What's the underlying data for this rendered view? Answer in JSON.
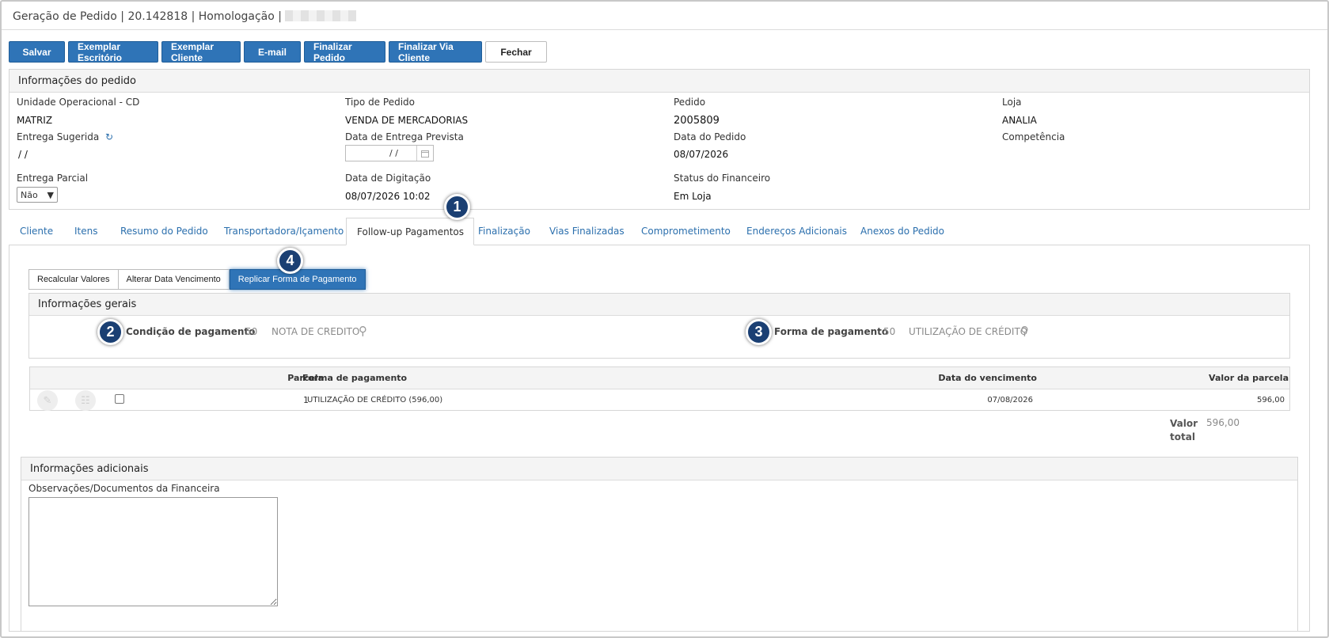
{
  "window": {
    "title": "Geração de Pedido | 20.142818 | Homologação |"
  },
  "toolbar": {
    "buttons": [
      "Salvar",
      "Exemplar Escritório",
      "Exemplar Cliente",
      "E-mail",
      "Finalizar Pedido",
      "Finalizar Via Cliente",
      "Fechar"
    ]
  },
  "info": {
    "header": "Informações do pedido",
    "unidade_label": "Unidade Operacional - CD",
    "unidade_value": "MATRIZ",
    "tipo_label": "Tipo de Pedido",
    "tipo_value": "VENDA DE MERCADORIAS",
    "pedido_label": "Pedido",
    "pedido_value": "2005809",
    "loja_label": "Loja",
    "loja_value": "ANALIA",
    "entrega_sugerida_label": "Entrega Sugerida",
    "entrega_sugerida_value": "/ /",
    "data_entrega_label": "Data de Entrega Prevista",
    "data_entrega_value": "/ /",
    "data_pedido_label": "Data do Pedido",
    "data_pedido_value": "08/07/2026",
    "competencia_label": "Competência",
    "entrega_parcial_label": "Entrega Parcial",
    "entrega_parcial_value": "Não",
    "data_digitacao_label": "Data de Digitação",
    "data_digitacao_value": "08/07/2026 10:02",
    "status_fin_label": "Status do Financeiro",
    "status_fin_value": "Em Loja"
  },
  "tabs": [
    "Cliente",
    "Itens",
    "Resumo do Pedido",
    "Transportadora/Içamento",
    "Follow-up Pagamentos",
    "Finalização",
    "Vias Finalizadas",
    "Comprometimento",
    "Endereços Adicionais",
    "Anexos do Pedido"
  ],
  "active_tab": "Follow-up Pagamentos",
  "sub_buttons": [
    "Recalcular Valores",
    "Alterar Data Vencimento",
    "Replicar Forma de Pagamento"
  ],
  "geral": {
    "header": "Informações gerais",
    "condicao_label": "Condição de pagamento",
    "condicao_code": "50",
    "condicao_desc": "NOTA DE CREDITO",
    "forma_label": "Forma de pagamento",
    "forma_code": "50",
    "forma_desc": "UTILIZAÇÃO DE CRÉDITO"
  },
  "grid": {
    "columns": [
      "Parcela",
      "Forma de pagamento",
      "Data do vencimento",
      "Valor da parcela"
    ],
    "rows": [
      {
        "parcela": "1",
        "forma": "UTILIZAÇÃO DE CRÉDITO (596,00)",
        "vencimento": "07/08/2026",
        "valor": "596,00"
      }
    ]
  },
  "total": {
    "label_1": "Valor",
    "label_2": "total",
    "value": "596,00"
  },
  "adicionais": {
    "header": "Informações adicionais",
    "obs_label": "Observações/Documentos da Financeira",
    "obs_value": ""
  },
  "markers": [
    "1",
    "2",
    "3",
    "4"
  ],
  "colors": {
    "primary_button": "#2f74b7",
    "link": "#2b6fad",
    "marker": "#1a3f73"
  }
}
